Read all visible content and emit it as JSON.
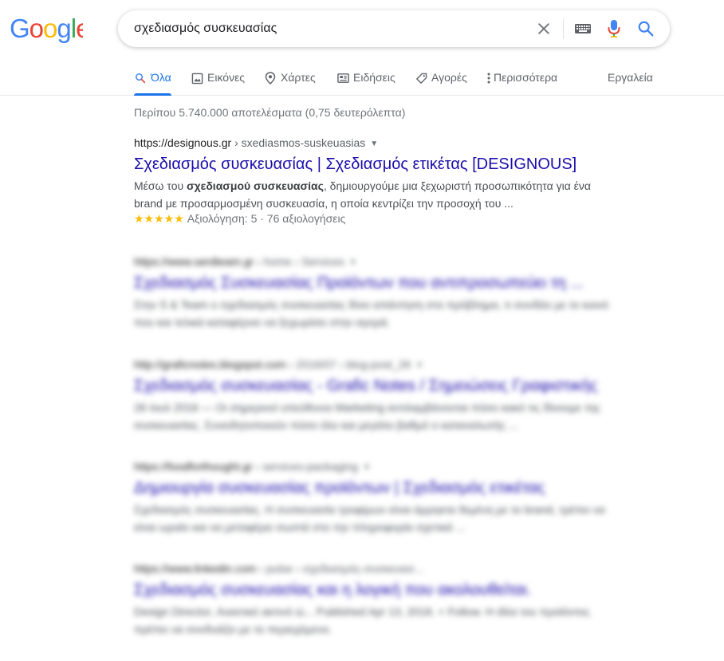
{
  "logo": {
    "text": "Google"
  },
  "search": {
    "query": "σχεδιασμός συσκευασίας",
    "clear_icon": "close-icon",
    "keyboard_icon": "keyboard-icon",
    "mic_icon": "microphone-icon",
    "search_icon": "search-icon"
  },
  "tabs": [
    {
      "label": "Όλα",
      "icon": "search-icon",
      "active": true
    },
    {
      "label": "Εικόνες",
      "icon": "image-icon"
    },
    {
      "label": "Χάρτες",
      "icon": "map-pin-icon"
    },
    {
      "label": "Ειδήσεις",
      "icon": "news-icon"
    },
    {
      "label": "Αγορές",
      "icon": "tag-icon"
    },
    {
      "label": "Περισσότερα",
      "icon": "more-vert-icon"
    }
  ],
  "tools_label": "Εργαλεία",
  "stats": "Περίπου 5.740.000 αποτελέσματα (0,75 δευτερόλεπτα)",
  "results": [
    {
      "url": "https://designous.gr",
      "breadcrumb": " › sxediasmos-suskeuasias",
      "title": "Σχεδιασμός συσκευασίας | Σχεδιασμός ετικέτας [DESIGNOUS]",
      "snippet_pre": "Μέσω του ",
      "snippet_bold": "σχεδιασμού συσκευασίας",
      "snippet_post": ", δημιουργούμε μια ξεχωριστή προσωπικότητα για ένα brand με προσαρμοσμένη συσκευασία, η οποία κεντρίζει την προσοχή του ...",
      "stars": "★★★★★",
      "rating": "Αξιολόγηση: 5 · 76 αξιολογήσεις"
    },
    {
      "url": "https://www.serdteam.gr",
      "breadcrumb": " › home › Services",
      "title": "Σχεδιασμός Συσκευασίας Προϊόντων που αντιπροσωπεύει τη ...",
      "snippet": "Στην S & Team ο σχεδιασμός συσκευασίας δίνει απάντηση στο πρόβλημα, τι συνδέει με το κοινό που και τελικά καταφέρνει να ξεχωρίσει στην αγορά."
    },
    {
      "url": "http://graficnotes.blogspot.com",
      "breadcrumb": " › 2016/07 › blog-post_26",
      "title": "Σχεδιασμός συσκευασίας - Grafic Notes / Σημειώσεις Γραφιστικής",
      "snippet": "26 Ιουλ 2016 — Οι σημερινοί υπεύθυνοι Marketing αντιλαμβάνονται πόσο κακό τις δίνουμε της συσκευασίας. Συνειδητοποιούν πόσο όλο και μεγάλο βαθμό ο καταναλωτής ..."
    },
    {
      "url": "https://foodforthought.gr",
      "breadcrumb": " › services-packaging",
      "title": "Δημιουργία συσκευασίας προϊόντων | Σχεδιασμός ετικέτας",
      "snippet": "Σχεδιασμός συσκευασίας. Η συσκευασία τροφίμων είναι άρρηκτα δεμένη με το brand, τρέπει να είναι ωραίο και να μεταφέρει σωστά στο την πληροφορία σχετικά ..."
    },
    {
      "url": "https://www.linkedin.com",
      "breadcrumb": " › pulse › σχεδιασμός-συσκευασ...",
      "title": "Σχεδιασμός συσκευασίας και η λογική που ακολουθείται.",
      "snippet": "Design Director, Ανεκτικό ακτινό ώ... Published Apr 13, 2018. + Follow. Η ιδέα του προϊόντος πρέπει να συνδυάζει με το περιεχόμενο."
    }
  ],
  "colors": {
    "google_blue": "#4285F4",
    "google_red": "#EA4335",
    "google_yellow": "#FBBC05",
    "google_green": "#34A853",
    "link_title": "#1a0dab",
    "accent": "#1a73e8",
    "star": "#fbbc04"
  }
}
